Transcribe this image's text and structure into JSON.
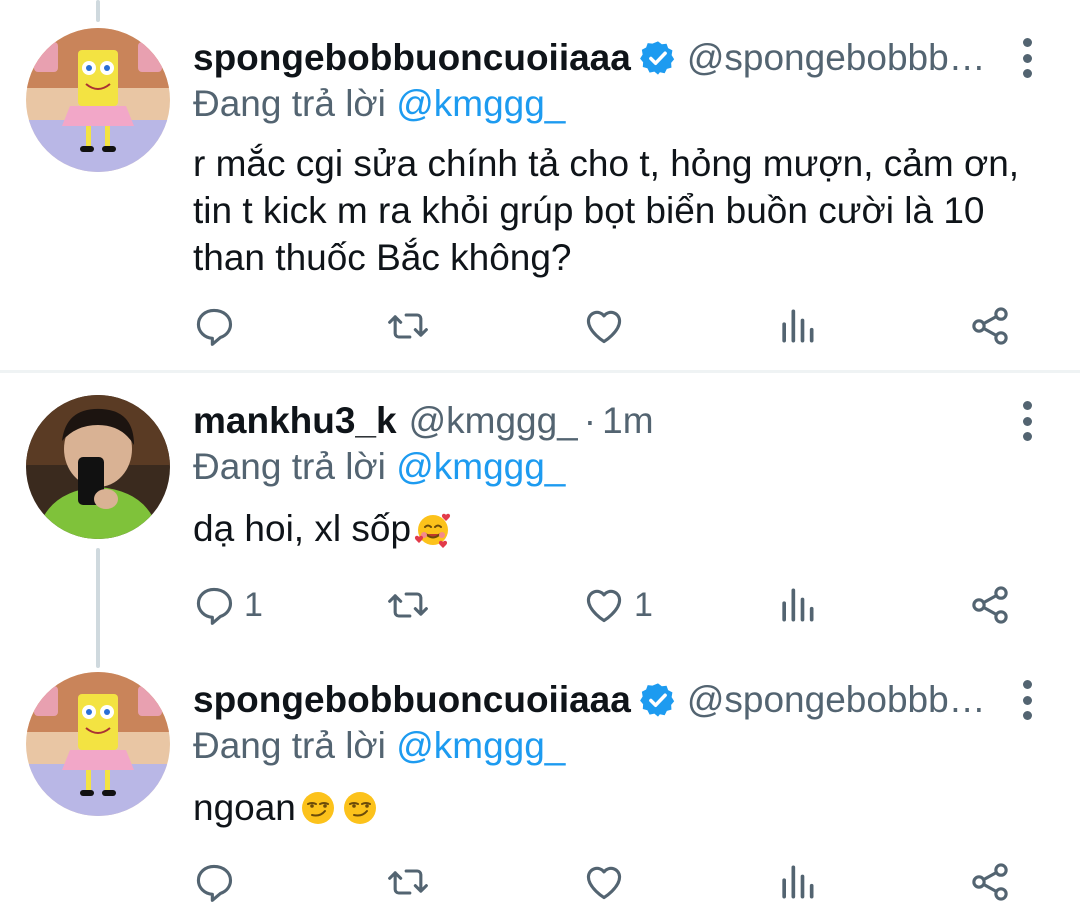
{
  "tweets": [
    {
      "name": "spongebobbuoncuoiiaaa",
      "verified": true,
      "handle": "@spongebobbb…",
      "time": "",
      "replying_prefix": "Đang trả lời ",
      "replying_to": "@kmggg_",
      "text": "r mắc cgi sửa chính tả cho t, hỏng mượn, cảm ơn, tin t kick m ra khỏi grúp bọt biển buồn cười là 10 than thuốc Bắc không?",
      "emojis": [],
      "reply_count": "",
      "retweet_count": "",
      "like_count": ""
    },
    {
      "name": "mankhu3_k",
      "verified": false,
      "handle": "@kmggg_",
      "time": "1m",
      "replying_prefix": "Đang trả lời ",
      "replying_to": "@kmggg_",
      "text": "dạ hoi, xl sốp",
      "emojis": [
        "smiling-face-with-hearts"
      ],
      "reply_count": "1",
      "retweet_count": "",
      "like_count": "1"
    },
    {
      "name": "spongebobbuoncuoiiaaa",
      "verified": true,
      "handle": "@spongebobbb…",
      "time": "",
      "replying_prefix": "Đang trả lời ",
      "replying_to": "@kmggg_",
      "text": "ngoan",
      "emojis": [
        "smirking-face",
        "smirking-face"
      ],
      "reply_count": "",
      "retweet_count": "",
      "like_count": ""
    }
  ],
  "colors": {
    "accent": "#1d9bf0",
    "secondary_text": "#536471",
    "primary_text": "#0f1419",
    "divider": "#eff3f4",
    "thread_line": "#cfd9de"
  },
  "icons": {
    "reply": "reply-icon",
    "retweet": "retweet-icon",
    "like": "heart-icon",
    "analytics": "analytics-icon",
    "share": "share-icon",
    "more": "more-vertical-icon",
    "verified": "verified-badge-icon"
  }
}
